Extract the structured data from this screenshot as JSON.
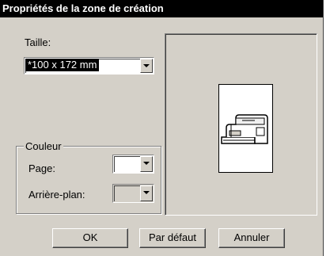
{
  "dialog": {
    "title": "Propriétés de la zone de création",
    "size": {
      "label": "Taille:",
      "selected_value": "*100 x 172 mm"
    },
    "color_group": {
      "legend": "Couleur",
      "page_label": "Page:",
      "background_label": "Arrière-plan:",
      "page_color": "#ffffff",
      "background_color": "#d4d0c8"
    },
    "buttons": {
      "ok": "OK",
      "default": "Par défaut",
      "cancel": "Annuler"
    }
  },
  "colors": {
    "titlebar": "#000000",
    "dialog_bg": "#d4d0c8",
    "selection": "#000000"
  }
}
